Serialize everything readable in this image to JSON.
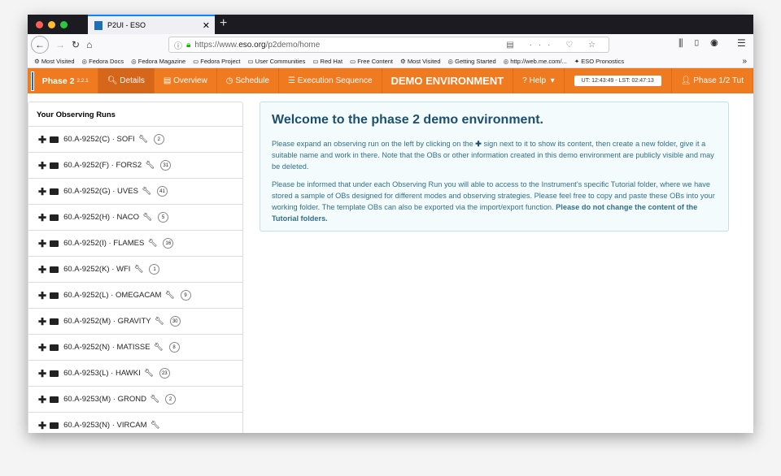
{
  "browser": {
    "tab_title": "P2UI - ESO",
    "url_prefix": "https://www.",
    "url_domain": "eso.org",
    "url_path": "/p2demo/home",
    "bookmarks": [
      "Most Visited",
      "Fedora Docs",
      "Fedora Magazine",
      "Fedora Project",
      "User Communities",
      "Red Hat",
      "Free Content",
      "Most Visited",
      "Getting Started",
      "http://web.me.com/...",
      "ESO Pronostics"
    ]
  },
  "nav": {
    "app": "Phase 2",
    "version": "2.2.1",
    "items": [
      "Details",
      "Overview",
      "Schedule",
      "Execution Sequence"
    ],
    "demo": "DEMO ENVIRONMENT",
    "help": "Help",
    "clock": "UT: 12:43:49 - LST: 02:47:13",
    "user": "Phase 1/2 Tut"
  },
  "sidebar": {
    "title": "Your Observing Runs",
    "runs": [
      {
        "label": "60.A-9252(C) · SOFI",
        "count": "2"
      },
      {
        "label": "60.A-9252(F) · FORS2",
        "count": "31"
      },
      {
        "label": "60.A-9252(G) · UVES",
        "count": "41"
      },
      {
        "label": "60.A-9252(H) · NACO",
        "count": "5"
      },
      {
        "label": "60.A-9252(I) · FLAMES",
        "count": "16"
      },
      {
        "label": "60.A-9252(K) · WFI",
        "count": "1"
      },
      {
        "label": "60.A-9252(L) · OMEGACAM",
        "count": "9"
      },
      {
        "label": "60.A-9252(M) · GRAVITY",
        "count": "30"
      },
      {
        "label": "60.A-9252(N) · MATISSE",
        "count": "8"
      },
      {
        "label": "60.A-9253(L) · HAWKI",
        "count": "23"
      },
      {
        "label": "60.A-9253(M) · GROND",
        "count": "2"
      },
      {
        "label": "60.A-9253(N) · VIRCAM",
        "count": ""
      }
    ]
  },
  "welcome": {
    "title": "Welcome to the phase 2 demo environment.",
    "p1a": "Please expand an observing run on the left by clicking on the",
    "p1b": "sign next to it to show its content, then create a new folder, give it a suitable name and work in there. Note that the OBs or other information created in this demo environment are publicly visible and may be deleted.",
    "p2": "Please be informed that under each Observing Run you will able to access to the Instrument's specific Tutorial folder, where we have stored a sample of OBs designed for different modes and observing strategies. Please feel free to copy and paste these OBs into your working folder. The template OBs can also be exported via the import/export function.",
    "p2b": "Please do not change the content of the Tutorial folders."
  }
}
